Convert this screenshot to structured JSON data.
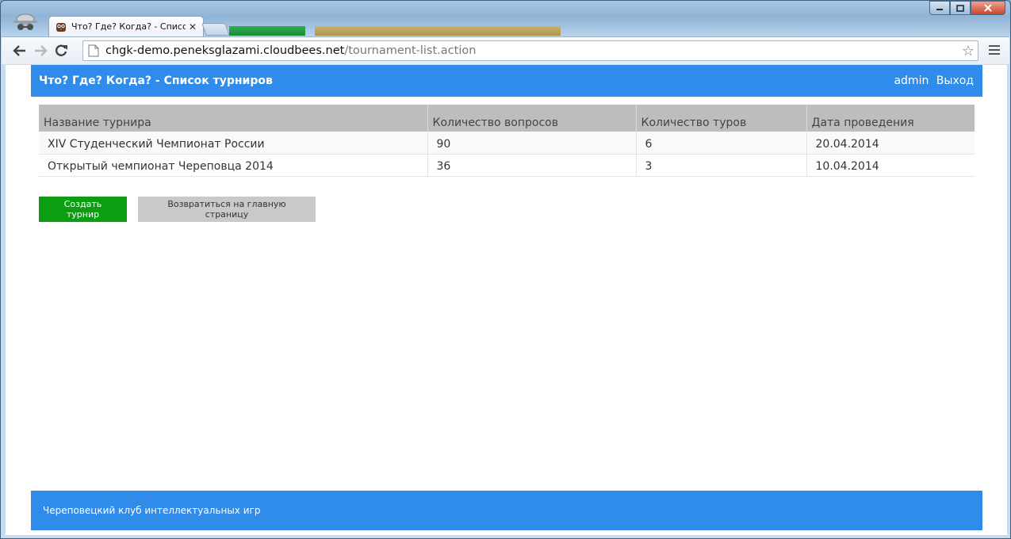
{
  "browser": {
    "tab": {
      "title": "Что? Где? Когда? - Списо",
      "close": "✕"
    },
    "url": {
      "host": "chgk-demo.peneksglazami.cloudbees.net",
      "path": "/tournament-list.action"
    }
  },
  "header": {
    "title": "Что? Где? Когда? - Список турниров",
    "user": "admin",
    "logout": "Выход"
  },
  "table": {
    "columns": [
      "Название турнира",
      "Количество вопросов",
      "Количество туров",
      "Дата проведения"
    ],
    "rows": [
      [
        "XIV Студенческий Чемпионат России",
        "90",
        "6",
        "20.04.2014"
      ],
      [
        "Открытый чемпионат Череповца 2014",
        "36",
        "3",
        "10.04.2014"
      ]
    ]
  },
  "actions": {
    "create_label": "Создать турнир",
    "back_label": "Возвратиться на главную страницу"
  },
  "footer": {
    "text": "Череповецкий клуб интеллектуальных игр"
  },
  "colors": {
    "brand_blue": "#2f8ceb",
    "create_green": "#0b9e10",
    "table_header_gray": "#bdbdbd"
  }
}
